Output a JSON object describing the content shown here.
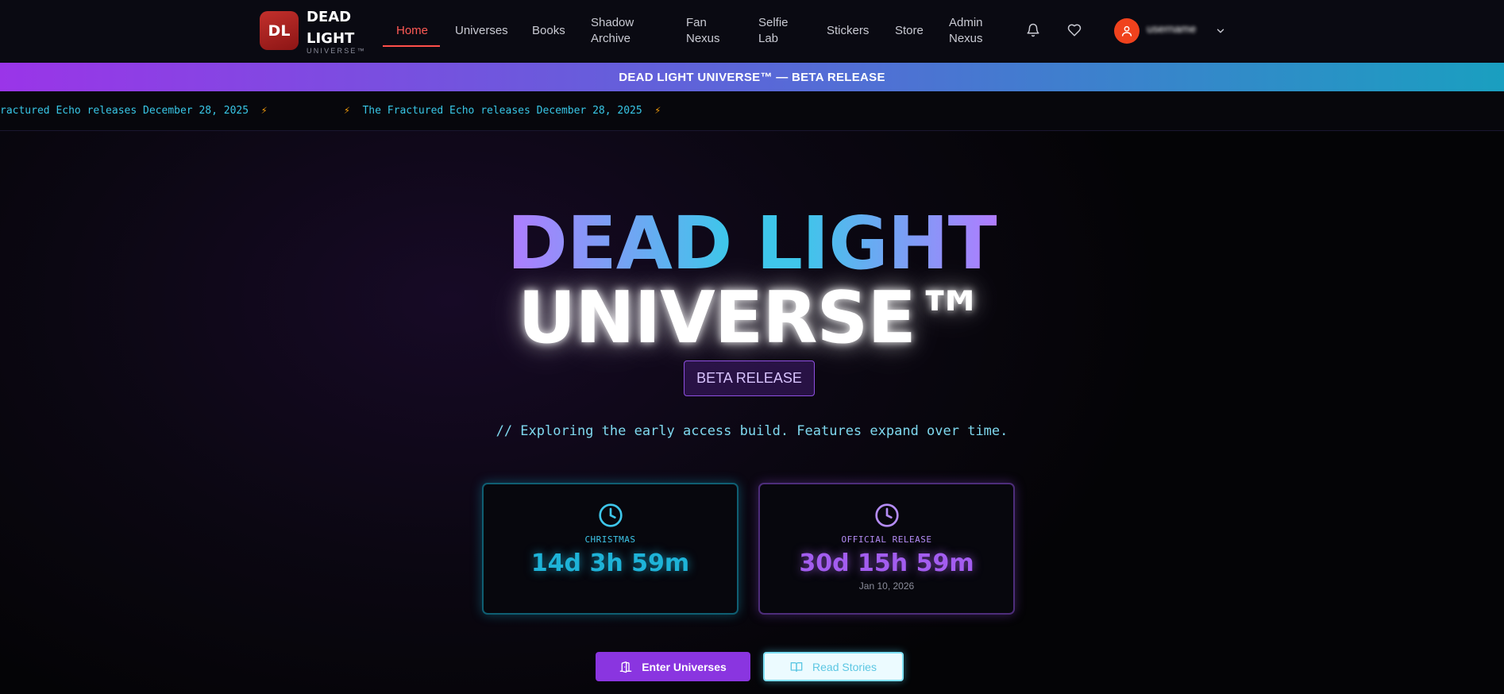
{
  "nav": {
    "logo_text": "DL",
    "brand_line1": "DEAD",
    "brand_line2": "LIGHT",
    "brand_sub": "UNIVERSE™",
    "items": [
      {
        "line1": "Home",
        "line2": ""
      },
      {
        "line1": "Universes",
        "line2": ""
      },
      {
        "line1": "Books",
        "line2": ""
      },
      {
        "line1": "Shadow",
        "line2": "Archive"
      },
      {
        "line1": "Fan",
        "line2": "Nexus"
      },
      {
        "line1": "Selfie",
        "line2": "Lab"
      },
      {
        "line1": "Stickers",
        "line2": ""
      },
      {
        "line1": "Store",
        "line2": ""
      },
      {
        "line1": "Admin",
        "line2": "Nexus"
      }
    ],
    "active_item": "Home",
    "user_name": "username"
  },
  "banner": {
    "text": "DEAD LIGHT UNIVERSE™ — BETA RELEASE"
  },
  "ticker": {
    "item1": "ractured Echo releases December 28, 2025",
    "item2": "The Fractured Echo releases December 28, 2025"
  },
  "hero": {
    "title_line1": "DEAD LIGHT",
    "title_line2": "UNIVERSE™",
    "badge": "BETA RELEASE",
    "tagline": "// Exploring the early access build. Features expand over time."
  },
  "countdowns": [
    {
      "label": "CHRISTMAS",
      "value": "14d 3h 59m",
      "date": ""
    },
    {
      "label": "OFFICIAL RELEASE",
      "value": "30d 15h 59m",
      "date": "Jan 10, 2026"
    }
  ],
  "buttons": {
    "primary": "Enter Universes",
    "secondary": "Read Stories"
  },
  "colors": {
    "accent_red": "#ff5a55",
    "cyan": "#3ec6ea",
    "violet": "#a35df0",
    "primary_button": "#8a35e0"
  }
}
